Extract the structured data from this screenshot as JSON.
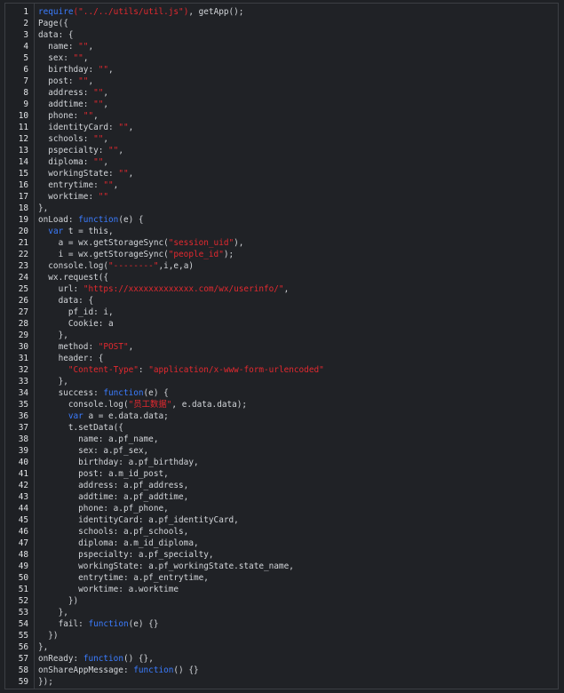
{
  "colors": {
    "background": "#202226",
    "text": "#d3d6da",
    "string": "#e3292f",
    "keyword": "#3b7cff",
    "line_number": "#e2e4e7"
  },
  "lines": [
    [
      [
        "k",
        "require"
      ],
      [
        "s",
        "(\"../../utils/util.js\")"
      ],
      [
        "p",
        ", getApp();"
      ]
    ],
    [
      [
        "p",
        "Page({"
      ]
    ],
    [
      [
        "p",
        "data: {"
      ]
    ],
    [
      [
        "p",
        "  name: "
      ],
      [
        "s",
        "\"\""
      ],
      [
        "p",
        ","
      ]
    ],
    [
      [
        "p",
        "  sex: "
      ],
      [
        "s",
        "\"\""
      ],
      [
        "p",
        ","
      ]
    ],
    [
      [
        "p",
        "  birthday: "
      ],
      [
        "s",
        "\"\""
      ],
      [
        "p",
        ","
      ]
    ],
    [
      [
        "p",
        "  post: "
      ],
      [
        "s",
        "\"\""
      ],
      [
        "p",
        ","
      ]
    ],
    [
      [
        "p",
        "  address: "
      ],
      [
        "s",
        "\"\""
      ],
      [
        "p",
        ","
      ]
    ],
    [
      [
        "p",
        "  addtime: "
      ],
      [
        "s",
        "\"\""
      ],
      [
        "p",
        ","
      ]
    ],
    [
      [
        "p",
        "  phone: "
      ],
      [
        "s",
        "\"\""
      ],
      [
        "p",
        ","
      ]
    ],
    [
      [
        "p",
        "  identityCard: "
      ],
      [
        "s",
        "\"\""
      ],
      [
        "p",
        ","
      ]
    ],
    [
      [
        "p",
        "  schools: "
      ],
      [
        "s",
        "\"\""
      ],
      [
        "p",
        ","
      ]
    ],
    [
      [
        "p",
        "  pspecialty: "
      ],
      [
        "s",
        "\"\""
      ],
      [
        "p",
        ","
      ]
    ],
    [
      [
        "p",
        "  diploma: "
      ],
      [
        "s",
        "\"\""
      ],
      [
        "p",
        ","
      ]
    ],
    [
      [
        "p",
        "  workingState: "
      ],
      [
        "s",
        "\"\""
      ],
      [
        "p",
        ","
      ]
    ],
    [
      [
        "p",
        "  entrytime: "
      ],
      [
        "s",
        "\"\""
      ],
      [
        "p",
        ","
      ]
    ],
    [
      [
        "p",
        "  worktime: "
      ],
      [
        "s",
        "\"\""
      ]
    ],
    [
      [
        "p",
        "},"
      ]
    ],
    [
      [
        "p",
        "onLoad: "
      ],
      [
        "k",
        "function"
      ],
      [
        "p",
        "(e) {"
      ]
    ],
    [
      [
        "p",
        "  "
      ],
      [
        "k",
        "var"
      ],
      [
        "p",
        " t = this,"
      ]
    ],
    [
      [
        "p",
        "    a = wx.getStorageSync("
      ],
      [
        "s",
        "\"session_uid\""
      ],
      [
        "p",
        "),"
      ]
    ],
    [
      [
        "p",
        "    i = wx.getStorageSync("
      ],
      [
        "s",
        "\"people_id\""
      ],
      [
        "p",
        ");"
      ]
    ],
    [
      [
        "p",
        "  console.log("
      ],
      [
        "s",
        "\"--------\""
      ],
      [
        "p",
        ",i,e,a)"
      ]
    ],
    [
      [
        "p",
        "  wx.request({"
      ]
    ],
    [
      [
        "p",
        "    url: "
      ],
      [
        "s",
        "\"https://xxxxxxxxxxxxx.com/wx/userinfo/\""
      ],
      [
        "p",
        ","
      ]
    ],
    [
      [
        "p",
        "    data: {"
      ]
    ],
    [
      [
        "p",
        "      pf_id: i,"
      ]
    ],
    [
      [
        "p",
        "      Cookie: a"
      ]
    ],
    [
      [
        "p",
        "    },"
      ]
    ],
    [
      [
        "p",
        "    method: "
      ],
      [
        "s",
        "\"POST\""
      ],
      [
        "p",
        ","
      ]
    ],
    [
      [
        "p",
        "    header: {"
      ]
    ],
    [
      [
        "p",
        "      "
      ],
      [
        "s",
        "\"Content-Type\""
      ],
      [
        "p",
        ": "
      ],
      [
        "s",
        "\"application/x-www-form-urlencoded\""
      ]
    ],
    [
      [
        "p",
        "    },"
      ]
    ],
    [
      [
        "p",
        "    success: "
      ],
      [
        "k",
        "function"
      ],
      [
        "p",
        "(e) {"
      ]
    ],
    [
      [
        "p",
        "      console.log("
      ],
      [
        "s",
        "\"员工数据\""
      ],
      [
        "p",
        ", e.data.data);"
      ]
    ],
    [
      [
        "p",
        "      "
      ],
      [
        "k",
        "var"
      ],
      [
        "p",
        " a = e.data.data;"
      ]
    ],
    [
      [
        "p",
        "      t.setData({"
      ]
    ],
    [
      [
        "p",
        "        name: a.pf_name,"
      ]
    ],
    [
      [
        "p",
        "        sex: a.pf_sex,"
      ]
    ],
    [
      [
        "p",
        "        birthday: a.pf_birthday,"
      ]
    ],
    [
      [
        "p",
        "        post: a.m_id_post,"
      ]
    ],
    [
      [
        "p",
        "        address: a.pf_address,"
      ]
    ],
    [
      [
        "p",
        "        addtime: a.pf_addtime,"
      ]
    ],
    [
      [
        "p",
        "        phone: a.pf_phone,"
      ]
    ],
    [
      [
        "p",
        "        identityCard: a.pf_identityCard,"
      ]
    ],
    [
      [
        "p",
        "        schools: a.pf_schools,"
      ]
    ],
    [
      [
        "p",
        "        diploma: a.m_id_diploma,"
      ]
    ],
    [
      [
        "p",
        "        pspecialty: a.pf_specialty,"
      ]
    ],
    [
      [
        "p",
        "        workingState: a.pf_workingState.state_name,"
      ]
    ],
    [
      [
        "p",
        "        entrytime: a.pf_entrytime,"
      ]
    ],
    [
      [
        "p",
        "        worktime: a.worktime"
      ]
    ],
    [
      [
        "p",
        "      })"
      ]
    ],
    [
      [
        "p",
        "    },"
      ]
    ],
    [
      [
        "p",
        "    fail: "
      ],
      [
        "k",
        "function"
      ],
      [
        "p",
        "(e) {}"
      ]
    ],
    [
      [
        "p",
        "  })"
      ]
    ],
    [
      [
        "p",
        "},"
      ]
    ],
    [
      [
        "p",
        "onReady: "
      ],
      [
        "k",
        "function"
      ],
      [
        "p",
        "() {},"
      ]
    ],
    [
      [
        "p",
        "onShareAppMessage: "
      ],
      [
        "k",
        "function"
      ],
      [
        "p",
        "() {}"
      ]
    ],
    [
      [
        "p",
        "});"
      ]
    ]
  ]
}
